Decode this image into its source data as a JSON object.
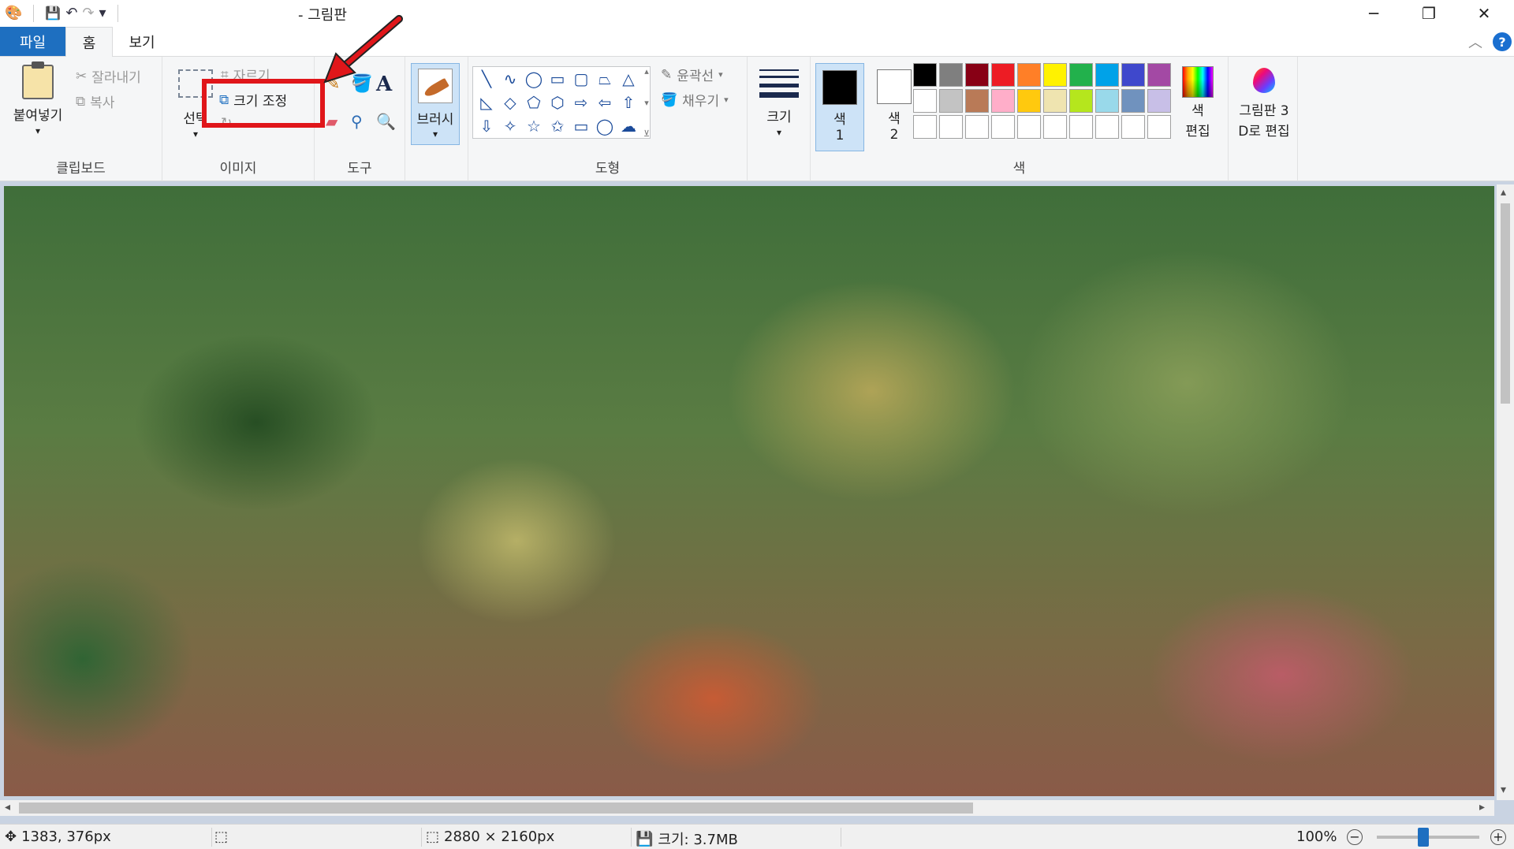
{
  "window": {
    "title": "- 그림판",
    "controls": {
      "minimize": "─",
      "restore": "❐",
      "close": "✕"
    }
  },
  "quick_access": {
    "save": "💾",
    "undo": "↶",
    "redo": "↷",
    "more": "▾"
  },
  "tabs": {
    "file": "파일",
    "home": "홈",
    "view": "보기"
  },
  "help": "?",
  "ribbon": {
    "clipboard": {
      "label": "클립보드",
      "paste": "붙여넣기",
      "cut": "잘라내기",
      "copy": "복사"
    },
    "image": {
      "label": "이미지",
      "select": "선택",
      "crop": "자르기",
      "resize": "크기 조정"
    },
    "tools": {
      "label": "도구"
    },
    "brush": "브러시",
    "shapes": {
      "label": "도형",
      "outline": "윤곽선",
      "fill": "채우기",
      "glyphs": [
        "╲",
        "∿",
        "◯",
        "▭",
        "▢",
        "⏢",
        "△",
        "◺",
        "◇",
        "⬠",
        "⬡",
        "⇨",
        "⇦",
        "⇧",
        "⇩",
        "✧",
        "☆",
        "✩",
        "▭",
        "◯",
        "☁"
      ]
    },
    "size": "크기",
    "colors": {
      "label": "색",
      "color1": "색\n1",
      "color1_a": "색",
      "color1_b": "1",
      "color2_a": "색",
      "color2_b": "2",
      "color1_value": "#000000",
      "color2_value": "#ffffff",
      "palette": [
        "#000000",
        "#7f7f7f",
        "#880015",
        "#ed1c24",
        "#ff7f27",
        "#fff200",
        "#22b14c",
        "#00a2e8",
        "#3f48cc",
        "#a349a4",
        "#ffffff",
        "#c3c3c3",
        "#b97a57",
        "#ffaec9",
        "#ffc90e",
        "#efe4b0",
        "#b5e61d",
        "#99d9ea",
        "#7092be",
        "#c8bfe7",
        "#ffffff",
        "#ffffff",
        "#ffffff",
        "#ffffff",
        "#ffffff",
        "#ffffff",
        "#ffffff",
        "#ffffff",
        "#ffffff",
        "#ffffff"
      ],
      "edit_colors_a": "색",
      "edit_colors_b": "편집",
      "paint3d_a": "그림판 3",
      "paint3d_b": "D로 편집"
    }
  },
  "statusbar": {
    "cursor_pos": "1383, 376px",
    "image_size": "2880 × 2160px",
    "file_size": "크기: 3.7MB",
    "zoom": "100%",
    "zoom_fraction": 0.45
  },
  "accent": "#1e6fc0",
  "annotation_color": "#e0161a"
}
